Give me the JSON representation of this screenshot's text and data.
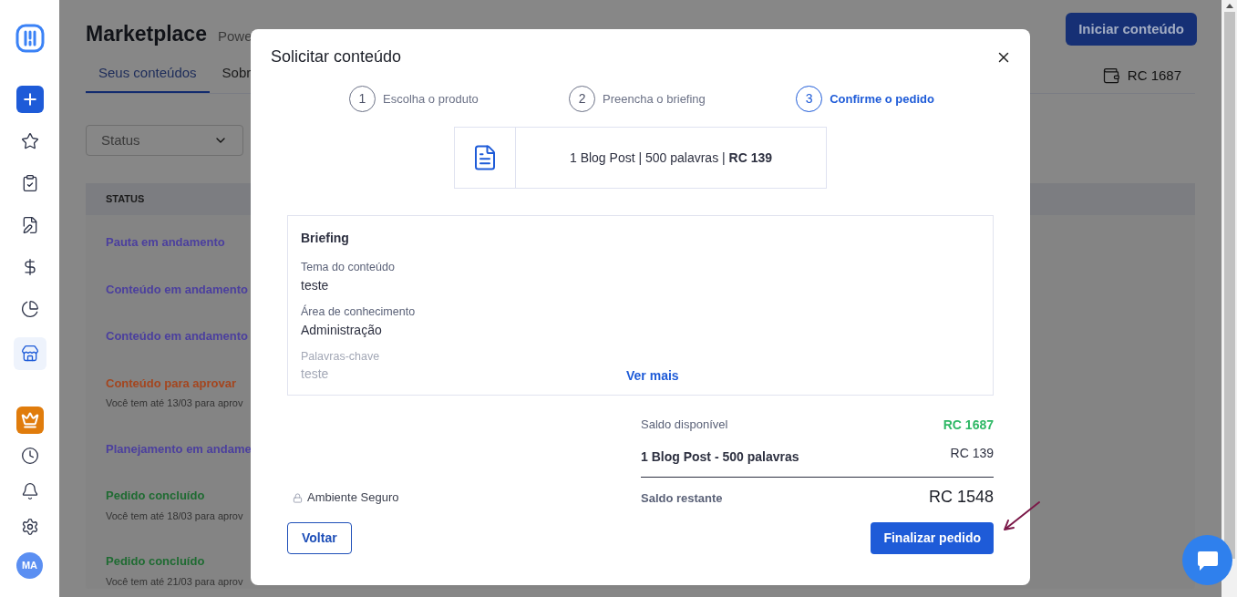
{
  "sidebar": {
    "items": [
      {
        "selected": false
      },
      {
        "selected": false
      },
      {
        "selected": false
      },
      {
        "selected": false
      },
      {
        "selected": false
      },
      {
        "selected": true
      }
    ],
    "bottom_items": [
      {
        "selected": false
      },
      {
        "selected": false
      },
      {
        "selected": false
      }
    ],
    "avatar": "MA"
  },
  "header": {
    "title": "Marketplace",
    "subtitle": "Powe",
    "button": "Iniciar conteúdo",
    "balance": "RC 1687"
  },
  "tabs": [
    {
      "label": "Seus conteúdos",
      "selected": true
    },
    {
      "label": "Sobr",
      "selected": false
    }
  ],
  "filter": {
    "placeholder": "Status"
  },
  "table": {
    "columns": [
      "STATUS"
    ],
    "rows": [
      {
        "status": "Pauta em andamento",
        "color": "#4b3f9e"
      },
      {
        "status": "Conteúdo em andamento",
        "color": "#4b3f9e"
      },
      {
        "status": "Conteúdo em andamento",
        "color": "#4b3f9e"
      },
      {
        "status": "Conteúdo para aprovar",
        "color": "#a4461f",
        "note": "Você tem até 13/03 para aprov"
      },
      {
        "status": "Planejamento em andame",
        "color": "#4b3f9e"
      },
      {
        "status": "Pedido concluído",
        "color": "#1f6b32",
        "note": "Você tem até 18/03 para aprov"
      },
      {
        "status": "Pedido concluído",
        "color": "#1f6b32",
        "note": "Você tem até 21/03 para aprov"
      }
    ]
  },
  "modal": {
    "title": "Solicitar conteúdo",
    "steps": [
      {
        "number": "1",
        "label": "Escolha o produto",
        "selected": false
      },
      {
        "number": "2",
        "label": "Preencha o briefing",
        "selected": false
      },
      {
        "number": "3",
        "label": "Confirme o pedido",
        "selected": true
      }
    ],
    "product": "1 Blog Post | 500 palavras | **RC 139**",
    "briefing": {
      "title": "Briefing",
      "fields": [
        {
          "label": "Tema do conteúdo",
          "value": "teste",
          "faded": false
        },
        {
          "label": "Área de conhecimento",
          "value": "Administração",
          "faded": false
        },
        {
          "label": "Palavras-chave",
          "value": "teste",
          "faded": true
        }
      ],
      "more": "Ver mais"
    },
    "secure": "Ambiente Seguro",
    "summary": {
      "available_label": "Saldo disponível",
      "available_value": "RC 1687",
      "item_label": "1 Blog Post - 500 palavras",
      "item_value": "RC 139",
      "remaining_label": "Saldo restante",
      "remaining_value": "RC 1548"
    },
    "back": "Voltar",
    "confirm": "Finalizar pedido"
  }
}
